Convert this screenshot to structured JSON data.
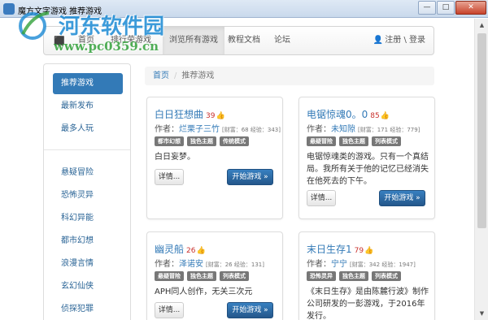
{
  "window": {
    "title": "魔方文字游戏 推荐游戏",
    "min_label": "—",
    "max_label": "□",
    "close_label": "✕"
  },
  "watermark": {
    "name": "河东软件园",
    "url": "www.pc0359.cn"
  },
  "navbar": {
    "brand_icon": "cube-icon",
    "items": [
      {
        "label": "首页"
      },
      {
        "label": "排行荣游戏"
      },
      {
        "label": "浏览所有游戏"
      },
      {
        "label": "教程文档"
      },
      {
        "label": "论坛"
      }
    ],
    "active_index": 2,
    "user_icon": "user-icon",
    "user_label": "注册 \\ 登录"
  },
  "sidebar": {
    "items": [
      {
        "label": "推荐游戏"
      },
      {
        "label": "最新发布"
      },
      {
        "label": "最多人玩"
      },
      {
        "label": "悬疑冒险"
      },
      {
        "label": "恐怖灵异"
      },
      {
        "label": "科幻异能"
      },
      {
        "label": "都市幻想"
      },
      {
        "label": "浪漫言情"
      },
      {
        "label": "玄幻仙侠"
      },
      {
        "label": "侦探犯罪"
      }
    ],
    "active_index": 0
  },
  "breadcrumb": {
    "home": "首页",
    "separator": "/",
    "current": "推荐游戏"
  },
  "cards": [
    {
      "title": "白日狂想曲",
      "likes": "39",
      "author_label": "作者：",
      "author": "烂栗子三竹",
      "meta": "[财富：68 经验：343]",
      "tags": [
        "都市幻想",
        "独色主题",
        "传统模式"
      ],
      "desc": "白日妄梦。",
      "detail_label": "详情...",
      "start_label": "开始游戏 »"
    },
    {
      "title": "电锯惊魂0。0",
      "likes": "85",
      "author_label": "作者：",
      "author": "未知隙",
      "meta": "[财富：171 经验：779]",
      "tags": [
        "悬疑冒险",
        "独色主题",
        "列表模式"
      ],
      "desc": "电锯惊魂类的游戏。只有一个真结局。我所有关于他的记忆已经消失在他死去的下午。",
      "detail_label": "详情...",
      "start_label": "开始游戏 »"
    },
    {
      "title": "幽灵船",
      "likes": "26",
      "author_label": "作者：",
      "author": "泽诺安",
      "meta": "[财富：26 经验：131]",
      "tags": [
        "悬疑冒险",
        "独色主题",
        "列表模式"
      ],
      "desc": "APH同人创作，无关三次元",
      "detail_label": "详情...",
      "start_label": "开始游戏 »"
    },
    {
      "title": "末日生存1",
      "likes": "79",
      "author_label": "作者：",
      "author": "宁宁",
      "meta": "[财富：342 经验：1947]",
      "tags": [
        "恐怖灵异",
        "独色主题",
        "列表模式"
      ],
      "desc": "《末日生存》是由陈麓行波》制作公司研发的一彭游戏，于2016年发行。",
      "detail_label": "详情...",
      "start_label": "开始游戏 »"
    }
  ],
  "like_icon": "thumbs-up-icon",
  "colors": {
    "link": "#337ab7",
    "active_sidebar": "#337ab7",
    "start_button": "#2d6ca2",
    "tag": "#777777",
    "likes": "#c9302c"
  }
}
